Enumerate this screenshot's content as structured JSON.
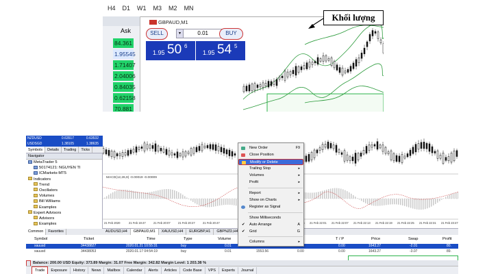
{
  "top_screenshot": {
    "timeframes": [
      "H4",
      "D1",
      "W1",
      "M3",
      "M2",
      "MN"
    ],
    "ask_header": "Ask",
    "ask_values": [
      "84.361",
      "1.95545",
      "1.71407",
      "2.04006",
      "0.84035",
      "0.62158",
      "70.881"
    ],
    "chart_title": "GBPAUD,M1",
    "sell_label": "SELL",
    "buy_label": "BUY",
    "lot_value": "0.01",
    "sell_price": {
      "small": "1.95",
      "big": "50",
      "sup": "6"
    },
    "buy_price": {
      "small": "1.95",
      "big": "54",
      "sup": "5"
    },
    "callout_label": "Khối lượng"
  },
  "bottom_screenshot": {
    "market_watch_rows": [
      {
        "symbol": "NZDUSD",
        "bid": "0.63517",
        "ask": "0.63532"
      },
      {
        "symbol": "USDSGD",
        "bid": "1.38105",
        "ask": "1.38635"
      }
    ],
    "mw_tabs": [
      "Symbols",
      "Details",
      "Trading",
      "Ticks"
    ],
    "navigator": {
      "header": "Navigator",
      "items": [
        "MetaTrader 5",
        "50174121: NGUYEN TI",
        "ICMarkets-MT5",
        "Indicators",
        "Trend",
        "Oscillators",
        "Volumes",
        "Bill Williams",
        "Examples",
        "Expert Advisors",
        "Advisors",
        "Examples"
      ],
      "tabs": [
        "Common",
        "Favorites"
      ]
    },
    "macd_label": "MACD(12,26,9) -0.00019 -0.00009",
    "chart_tabs": [
      "AUDUSD,H4",
      "GBPAUD,M1",
      "XAUUSD,H4",
      "EURGBP,H1",
      "GBPNZD,H4"
    ],
    "x_time_labels_left": [
      "21 Feb 2020",
      "21 Feb 19:47",
      "21 Feb 20:07",
      "21 Feb 20:27",
      "21 Feb 20:47"
    ],
    "x_time_labels_right": [
      "21 Feb 21:55",
      "21 Feb 22:01",
      "21 Feb 22:07",
      "21 Feb 22:13",
      "21 Feb 22:19",
      "21 Feb 22:25",
      "21 Feb 22:31",
      "21 Feb 23:47"
    ],
    "context_menu": {
      "items": [
        {
          "label": "New Order",
          "shortcut": "F9",
          "icon": "new-order-icon"
        },
        {
          "label": "Close Position",
          "shortcut": "",
          "icon": "close-position-icon"
        },
        {
          "label": "Modify or Delete",
          "shortcut": "",
          "icon": "modify-icon",
          "selected": true
        },
        {
          "label": "Trailing Stop",
          "shortcut": "",
          "submenu": true
        },
        {
          "label": "Volumes",
          "shortcut": "",
          "submenu": true
        },
        {
          "label": "Profit",
          "shortcut": "",
          "submenu": true
        },
        {
          "label": "Report",
          "shortcut": "",
          "submenu": true
        },
        {
          "label": "Show on Charts",
          "shortcut": "",
          "submenu": true
        },
        {
          "label": "Register as Signal",
          "shortcut": "",
          "icon": "signal-icon"
        },
        {
          "label": "Show Milliseconds",
          "shortcut": ""
        },
        {
          "label": "Auto Arrange",
          "shortcut": "A",
          "checked": true
        },
        {
          "label": "Grid",
          "shortcut": "G",
          "checked": true
        },
        {
          "label": "Columns",
          "shortcut": "",
          "submenu": true
        }
      ]
    },
    "table": {
      "headers": [
        "Symbol",
        "Ticket",
        "Time",
        "Type",
        "Volume",
        "/ L",
        "T / P",
        "Price",
        "Swap",
        "Profit"
      ],
      "rows": [
        {
          "symbol": "xauusd",
          "ticket": "34438827",
          "time": "2020.01.21 10:55:31",
          "type": "buy",
          "volume": "0.01",
          "sl": "1553.",
          "sl2": "0.00",
          "tp": "0.00",
          "price": "1643.27",
          "swap": "-2.01",
          "profit": "80."
        },
        {
          "symbol": "xauusd",
          "ticket": "34438053",
          "time": "2020.01.17 04:54:19",
          "type": "buy",
          "volume": "0.01",
          "sl": "1553.56",
          "sl2": "0.00",
          "tp": "0.00",
          "price": "1643.27",
          "swap": "-3.07",
          "profit": "89."
        }
      ]
    },
    "balance_text": "Balance: 200.00 USD  Equity: 373.89  Margin: 31.07  Free Margin: 342.82  Margin Level: 1 203.38 %",
    "terminal_tabs": [
      "Trade",
      "Exposure",
      "History",
      "News",
      "Mailbox",
      "Calendar",
      "Alerts",
      "Articles",
      "Code Base",
      "VPS",
      "Experts",
      "Journal"
    ]
  },
  "colors": {
    "accent": "#1a4dc5",
    "highlight": "#cc3333",
    "ask_green": "#21d36a"
  }
}
